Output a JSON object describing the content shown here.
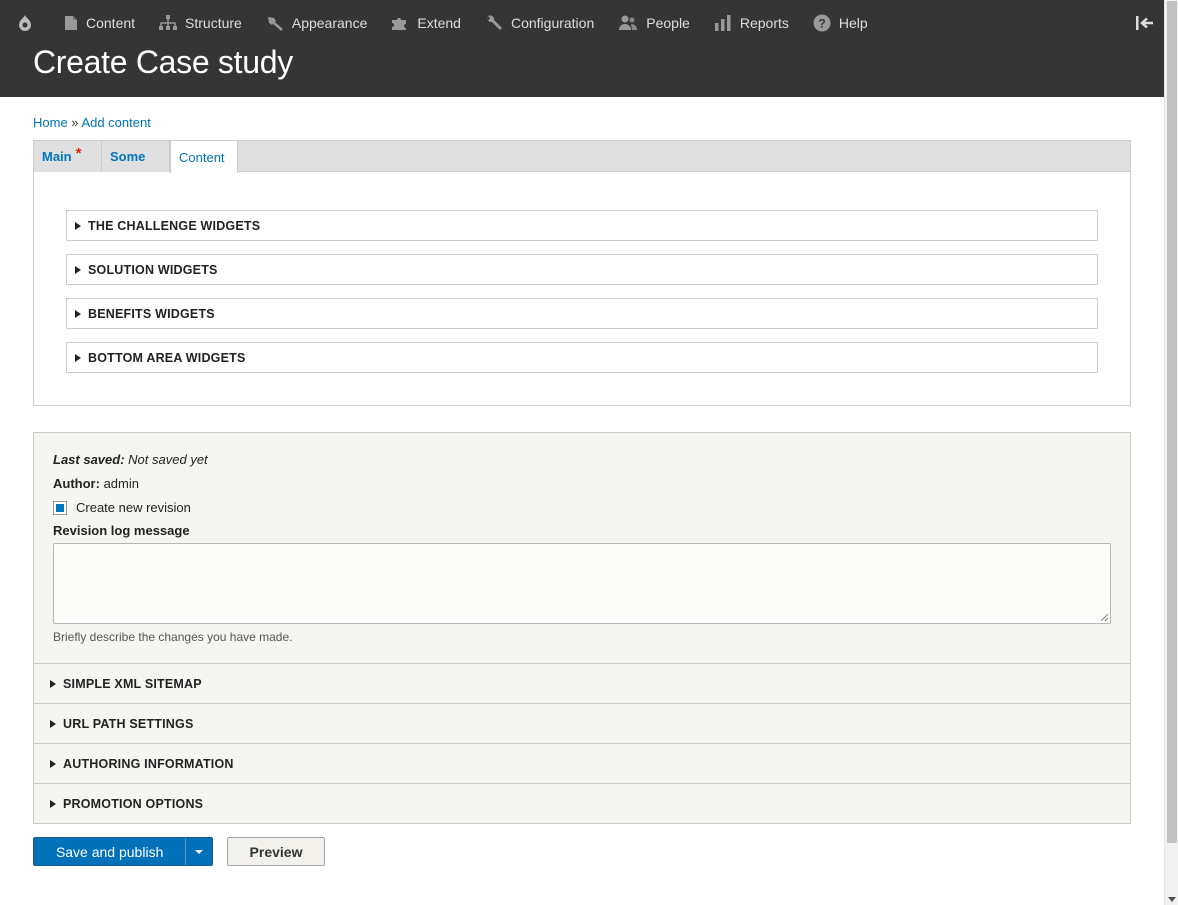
{
  "toolbar": {
    "items": [
      {
        "label": "Content",
        "icon": "file-icon"
      },
      {
        "label": "Structure",
        "icon": "sitemap-icon"
      },
      {
        "label": "Appearance",
        "icon": "paintbrush-icon"
      },
      {
        "label": "Extend",
        "icon": "puzzle-icon"
      },
      {
        "label": "Configuration",
        "icon": "wrench-icon"
      },
      {
        "label": "People",
        "icon": "people-icon"
      },
      {
        "label": "Reports",
        "icon": "bar-chart-icon"
      },
      {
        "label": "Help",
        "icon": "help-icon"
      }
    ]
  },
  "page": {
    "title": "Create Case study"
  },
  "breadcrumb": {
    "home": "Home",
    "separator": " » ",
    "add_content": "Add content"
  },
  "tabs": [
    {
      "label": "Main",
      "required": "*"
    },
    {
      "label": "Some"
    },
    {
      "label": "Content",
      "active": true
    }
  ],
  "widgets": [
    "THE CHALLENGE WIDGETS",
    "SOLUTION WIDGETS",
    "BENEFITS WIDGETS",
    "BOTTOM AREA WIDGETS"
  ],
  "meta": {
    "last_saved_label": "Last saved:",
    "last_saved_value": "Not saved yet",
    "author_label": "Author:",
    "author_value": "admin",
    "new_revision_label": "Create new revision",
    "new_revision_checked": true,
    "revision_log_label": "Revision log message",
    "revision_log_value": "",
    "revision_log_description": "Briefly describe the changes you have made.",
    "sections": [
      "SIMPLE XML SITEMAP",
      "URL PATH SETTINGS",
      "AUTHORING INFORMATION",
      "PROMOTION OPTIONS"
    ]
  },
  "actions": {
    "save_publish": "Save and publish",
    "preview": "Preview"
  },
  "colors": {
    "toolbar_bg": "#353535",
    "link": "#0074bd",
    "primary_button": "#0071b8"
  }
}
